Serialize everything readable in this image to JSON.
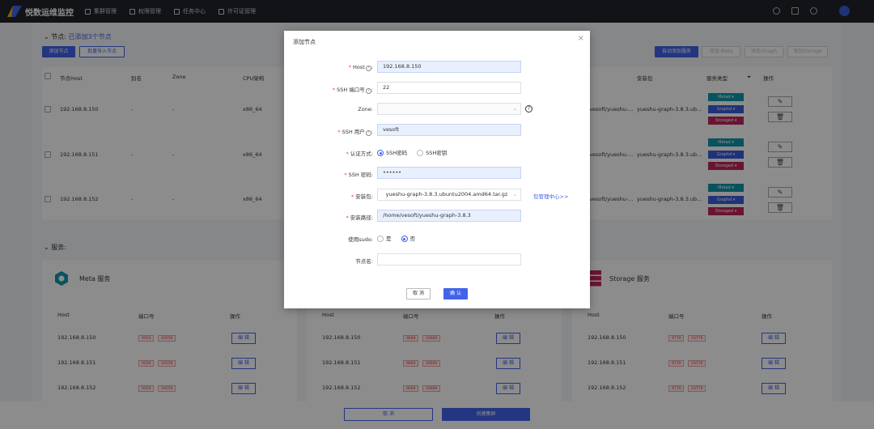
{
  "app": {
    "title": "悦数运维监控"
  },
  "nav": {
    "items": [
      "集群管理",
      "权限管理",
      "任务中心",
      "许可证管理"
    ]
  },
  "nodes": {
    "section_label": "节点:",
    "added_text": "已添加3个节点",
    "add_btn": "添加节点",
    "batch_btn": "批量导入节点",
    "auto_btn": "自动添加服务",
    "add_meta": "添加 Meta",
    "add_graph": "添加 Graph",
    "add_storage": "添加Storage",
    "columns": [
      "节点Host",
      "别名",
      "Zone",
      "CPU架构",
      "安装包",
      "服务类型",
      "操作"
    ],
    "rows": [
      {
        "host": "192.168.8.150",
        "alias": "-",
        "zone": "-",
        "cpu": "x86_64",
        "pkg_a": "vesoft/yueshu-...",
        "pkg_b": "yueshu-graph-3.8.3.ub..."
      },
      {
        "host": "192.168.8.151",
        "alias": "-",
        "zone": "-",
        "cpu": "x86_64",
        "pkg_a": "vesoft/yueshu-...",
        "pkg_b": "yueshu-graph-3.8.3.ub..."
      },
      {
        "host": "192.168.8.152",
        "alias": "-",
        "zone": "-",
        "cpu": "x86_64",
        "pkg_a": "vesoft/yueshu-...",
        "pkg_b": "yueshu-graph-3.8.3.ub..."
      }
    ],
    "svc_tags": [
      "Metad",
      "Graphd",
      "Storaged"
    ],
    "colors": {
      "metad": "#1098ad",
      "graphd": "#3b5bdb",
      "storaged": "#c2255c"
    }
  },
  "services": {
    "section_label": "服务:",
    "meta_title": "Meta 服务",
    "storage_title": "Storage 服务",
    "col_host": "Host",
    "col_port": "端口号",
    "col_op": "操作",
    "edit_label": "编 辑",
    "panels": [
      {
        "rows": [
          {
            "host": "192.168.8.150",
            "p1": "9559",
            "p2": "19559"
          },
          {
            "host": "192.168.8.151",
            "p1": "9559",
            "p2": "19559"
          },
          {
            "host": "192.168.8.152",
            "p1": "9559",
            "p2": "19559"
          }
        ]
      },
      {
        "rows": [
          {
            "host": "192.168.8.150",
            "p1": "9669",
            "p2": "19669"
          },
          {
            "host": "192.168.8.151",
            "p1": "9669",
            "p2": "19669"
          },
          {
            "host": "192.168.8.152",
            "p1": "9669",
            "p2": "19669"
          }
        ]
      },
      {
        "rows": [
          {
            "host": "192.168.8.150",
            "p1": "9779",
            "p2": "19779"
          },
          {
            "host": "192.168.8.151",
            "p1": "9779",
            "p2": "19779"
          },
          {
            "host": "192.168.8.152",
            "p1": "9779",
            "p2": "19779"
          }
        ]
      }
    ]
  },
  "footer": {
    "cancel": "取 消",
    "create": "创建集群"
  },
  "dialog": {
    "title": "添加节点",
    "host_label": "Host",
    "host_value": "192.168.8.150",
    "ssh_port_label": "SSH 端口号",
    "ssh_port_value": "22",
    "zone_label": "Zone:",
    "ssh_user_label": "SSH 用户",
    "ssh_user_value": "vesoft",
    "auth_label": "认证方式:",
    "auth_opt1": "SSH密码",
    "auth_opt2": "SSH密钥",
    "ssh_pwd_label": "SSH 密码:",
    "ssh_pwd_value": "••••••",
    "pkg_label": "安装包:",
    "pkg_value": "yueshu-graph-3.8.3.ubuntu2004.amd64.tar.gz",
    "pkg_link": "包管理中心>>",
    "path_label": "安装路径:",
    "path_value": "/home/vesoft/yueshu-graph-3.8.3",
    "sudo_label": "使用sudo:",
    "sudo_yes": "是",
    "sudo_no": "否",
    "nodename_label": "节点名:",
    "cancel": "取 消",
    "ok": "确 认"
  }
}
